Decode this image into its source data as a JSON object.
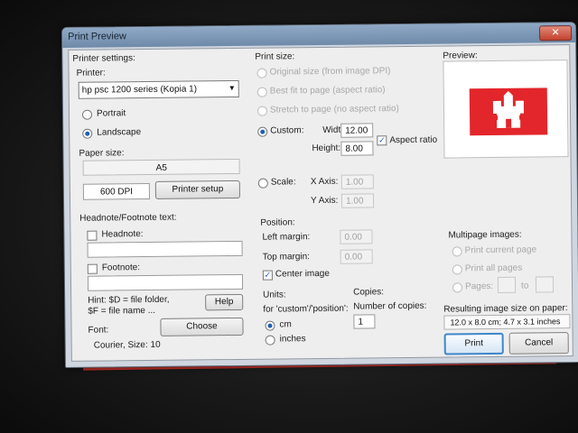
{
  "window": {
    "title": "Print Preview",
    "close_glyph": "✕"
  },
  "printer_settings": {
    "group_label": "Printer settings:",
    "printer_label": "Printer:",
    "printer_value": "hp psc 1200 series (Kopia 1)",
    "orientation": {
      "portrait_label": "Portrait",
      "landscape_label": "Landscape",
      "selected": "landscape"
    },
    "paper_size_label": "Paper size:",
    "paper_size_value": "A5",
    "dpi_value": "600 DPI",
    "printer_setup_label": "Printer setup"
  },
  "headnote": {
    "group_label": "Headnote/Footnote text:",
    "headnote_label": "Headnote:",
    "headnote_checked": false,
    "headnote_value": "",
    "footnote_label": "Footnote:",
    "footnote_checked": false,
    "footnote_value": "",
    "hint_line1": "Hint: $D = file folder,",
    "hint_line2": "$F = file name ...",
    "help_label": "Help",
    "font_label": "Font:",
    "choose_label": "Choose",
    "font_value": "Courier, Size: 10"
  },
  "print_size": {
    "group_label": "Print size:",
    "original_label": "Original size (from image DPI)",
    "best_fit_label": "Best fit to page (aspect ratio)",
    "stretch_label": "Stretch to page (no aspect ratio)",
    "custom_label": "Custom:",
    "width_label": "Width:",
    "width_value": "12.00",
    "height_label": "Height:",
    "height_value": "8.00",
    "aspect_label": "Aspect ratio",
    "aspect_checked": true,
    "scale_label": "Scale:",
    "x_axis_label": "X Axis:",
    "x_axis_value": "1.00",
    "y_axis_label": "Y Axis:",
    "y_axis_value": "1.00",
    "selected": "custom"
  },
  "position": {
    "group_label": "Position:",
    "left_margin_label": "Left margin:",
    "left_margin_value": "0.00",
    "top_margin_label": "Top margin:",
    "top_margin_value": "0.00",
    "center_label": "Center image",
    "center_checked": true
  },
  "units": {
    "group_label": "Units:",
    "sub_label": "for 'custom'/'position':",
    "cm_label": "cm",
    "inches_label": "inches",
    "selected": "cm"
  },
  "copies": {
    "group_label": "Copies:",
    "number_label": "Number of copies:",
    "value": "1"
  },
  "preview": {
    "label": "Preview:",
    "flag_color": "#e2262b"
  },
  "multipage": {
    "group_label": "Multipage images:",
    "current_label": "Print current page",
    "all_label": "Print all pages",
    "pages_label": "Pages:",
    "to_label": "to"
  },
  "result": {
    "label": "Resulting image size on paper:",
    "value": "12.0 x 8.0 cm; 4.7 x 3.1 inches"
  },
  "actions": {
    "print_label": "Print",
    "cancel_label": "Cancel"
  }
}
